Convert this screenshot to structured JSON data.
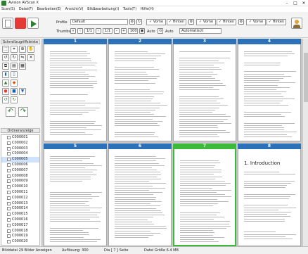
{
  "window": {
    "title": "Avision AVScan X"
  },
  "menu": [
    "Scan(S)",
    "Datei(F)",
    "Bearbeiten(E)",
    "Ansicht(V)",
    "Bildbearbeitung(I)",
    "Tools(T)",
    "Hilfe(H)"
  ],
  "toolbar": {
    "profile_label": "Profile",
    "profile_value": "Default",
    "thumbs_label": "Thumbs",
    "page_value": "1/1",
    "count_value": "1/1",
    "zoom_value": "100",
    "auto1": "Auto",
    "auto2": "Auto",
    "mode_value": "Automatisch",
    "toggles": [
      {
        "label": "Vorne",
        "mark": "✓"
      },
      {
        "label": "Hinten",
        "mark": "✓"
      },
      {
        "label": "Vorne",
        "mark": "✓"
      },
      {
        "label": "Hinten",
        "mark": "✓"
      },
      {
        "label": "Vorne",
        "mark": "✓"
      },
      {
        "label": "Hinten",
        "mark": "✓"
      }
    ]
  },
  "sidebar": {
    "tools_title": "Schnellzugriffsleiste",
    "order_title": "Ordneranzeige",
    "tree_items": [
      "C000001",
      "C000002",
      "C000003",
      "C000004",
      "C000005",
      "C000006",
      "C000007",
      "C000008",
      "C000009",
      "C000010",
      "C000011",
      "C000012",
      "C000013",
      "C000014",
      "C000015",
      "C000016",
      "C000017",
      "C000018",
      "C000019",
      "C000020"
    ]
  },
  "pages": [
    {
      "num": "1",
      "selected": false
    },
    {
      "num": "2",
      "selected": false
    },
    {
      "num": "3",
      "selected": false
    },
    {
      "num": "4",
      "selected": false
    },
    {
      "num": "5",
      "selected": false
    },
    {
      "num": "6",
      "selected": false
    },
    {
      "num": "7",
      "selected": true
    },
    {
      "num": "8",
      "selected": false
    }
  ],
  "page8_heading": "1. Introduction",
  "status": {
    "file": "Bilddatei 29 Bilder Anzeigen",
    "resolution": "Auflösung: 300",
    "page": "Dia [ 7 ] Seite",
    "size": "Datei Größe 6.4 MB"
  },
  "colors": {
    "page_header": "#2d72b8",
    "selected_border": "#3cba3c",
    "red": "#e53935",
    "green": "#2e7d32"
  }
}
